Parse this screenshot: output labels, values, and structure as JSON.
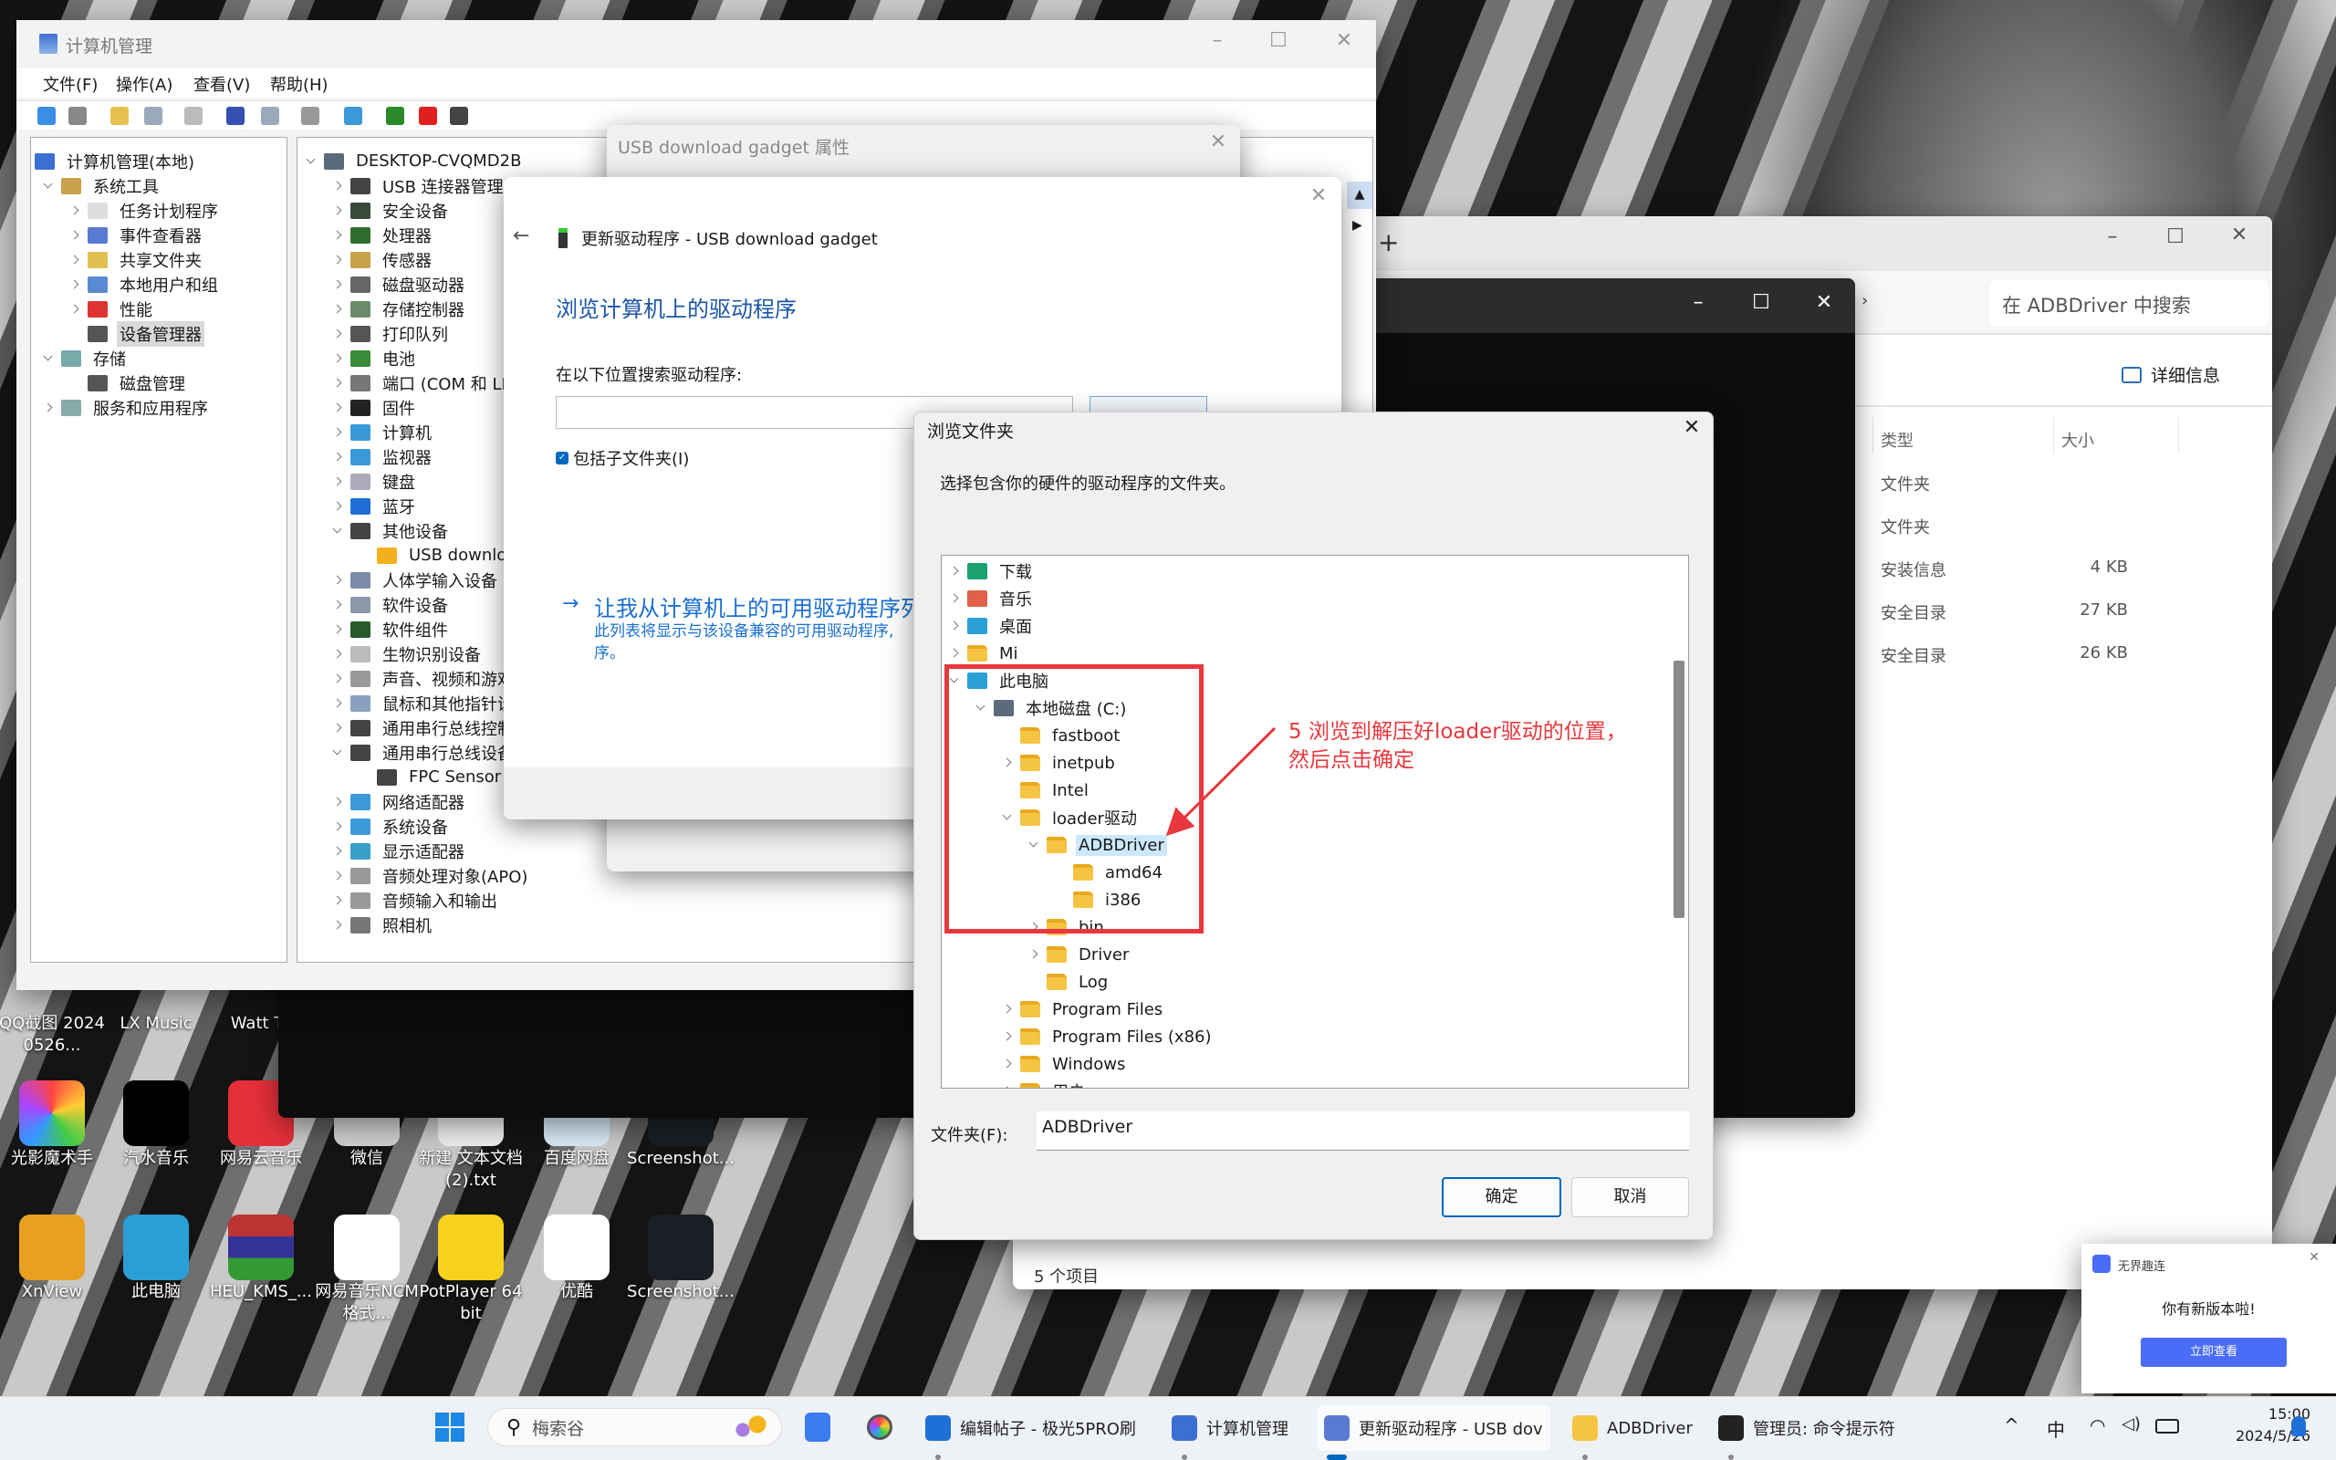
{
  "colors": {
    "accent": "#0067c0",
    "annotation_red": "#e8383d",
    "heading_blue": "#1c56a8",
    "notification_button": "#4a6cf7"
  },
  "desktop": {
    "row0": [
      {
        "label": "QQ截图 20240526..."
      },
      {
        "label": "LX Music"
      },
      {
        "label": "Watt To"
      }
    ],
    "row1": [
      {
        "label": "光影魔术手",
        "icon": "neo-imaging-icon"
      },
      {
        "label": "汽水音乐",
        "icon": "qishui-music-icon"
      },
      {
        "label": "网易云音乐",
        "icon": "netease-music-icon"
      },
      {
        "label": "微信",
        "icon": "wechat-icon"
      },
      {
        "label": "新建 文本文档 (2).txt",
        "icon": "text-file-icon"
      },
      {
        "label": "百度网盘",
        "icon": "baidu-netdisk-icon"
      },
      {
        "label": "Screenshot...",
        "icon": "screenshot-file-icon"
      }
    ],
    "row2": [
      {
        "label": "XnView",
        "icon": "xnview-icon"
      },
      {
        "label": "此电脑",
        "icon": "this-pc-icon"
      },
      {
        "label": "HEU_KMS_...",
        "icon": "winrar-icon"
      },
      {
        "label": "网易音乐NCM格式...",
        "icon": "ncm-converter-icon"
      },
      {
        "label": "PotPlayer 64 bit",
        "icon": "potplayer-icon"
      },
      {
        "label": "优酷",
        "icon": "youku-icon"
      },
      {
        "label": "Screenshot...",
        "icon": "screenshot-file-icon"
      }
    ]
  },
  "explorer": {
    "search_placeholder": "在 ADBDriver 中搜索",
    "details_label": "详细信息",
    "columns": [
      "类型",
      "大小"
    ],
    "rows": [
      {
        "type": "文件夹",
        "size": ""
      },
      {
        "type": "文件夹",
        "size": ""
      },
      {
        "type": "安装信息",
        "size": "4 KB"
      },
      {
        "type": "安全目录",
        "size": "27 KB"
      },
      {
        "type": "安全目录",
        "size": "26 KB"
      }
    ],
    "status": "5 个项目"
  },
  "computer_management": {
    "title": "计算机管理",
    "menu": [
      "文件(F)",
      "操作(A)",
      "查看(V)",
      "帮助(H)"
    ],
    "left_tree": [
      {
        "label": "计算机管理(本地)",
        "level": 0,
        "state": "none",
        "icon": "computer-management-icon"
      },
      {
        "label": "系统工具",
        "level": 1,
        "state": "expanded",
        "icon": "system-tools-icon"
      },
      {
        "label": "任务计划程序",
        "level": 2,
        "state": "collapsed",
        "icon": "task-scheduler-icon"
      },
      {
        "label": "事件查看器",
        "level": 2,
        "state": "collapsed",
        "icon": "event-viewer-icon"
      },
      {
        "label": "共享文件夹",
        "level": 2,
        "state": "collapsed",
        "icon": "shared-folders-icon"
      },
      {
        "label": "本地用户和组",
        "level": 2,
        "state": "collapsed",
        "icon": "users-icon"
      },
      {
        "label": "性能",
        "level": 2,
        "state": "collapsed",
        "icon": "performance-icon"
      },
      {
        "label": "设备管理器",
        "level": 2,
        "state": "none",
        "icon": "device-manager-icon",
        "selected": true
      },
      {
        "label": "存储",
        "level": 1,
        "state": "expanded",
        "icon": "storage-icon"
      },
      {
        "label": "磁盘管理",
        "level": 2,
        "state": "none",
        "icon": "disk-management-icon"
      },
      {
        "label": "服务和应用程序",
        "level": 1,
        "state": "collapsed",
        "icon": "services-icon"
      }
    ],
    "device_tree": [
      {
        "label": "DESKTOP-CVQMD2B",
        "level": 0,
        "state": "expanded",
        "icon": "computer-icon"
      },
      {
        "label": "USB 连接器管理器",
        "level": 1,
        "state": "collapsed",
        "icon": "usb-icon"
      },
      {
        "label": "安全设备",
        "level": 1,
        "state": "collapsed",
        "icon": "security-icon"
      },
      {
        "label": "处理器",
        "level": 1,
        "state": "collapsed",
        "icon": "processor-icon"
      },
      {
        "label": "传感器",
        "level": 1,
        "state": "collapsed",
        "icon": "sensor-icon"
      },
      {
        "label": "磁盘驱动器",
        "level": 1,
        "state": "collapsed",
        "icon": "disk-icon"
      },
      {
        "label": "存储控制器",
        "level": 1,
        "state": "collapsed",
        "icon": "storage-controller-icon"
      },
      {
        "label": "打印队列",
        "level": 1,
        "state": "collapsed",
        "icon": "printer-icon"
      },
      {
        "label": "电池",
        "level": 1,
        "state": "collapsed",
        "icon": "battery-icon"
      },
      {
        "label": "端口 (COM 和 LP",
        "level": 1,
        "state": "collapsed",
        "icon": "port-icon"
      },
      {
        "label": "固件",
        "level": 1,
        "state": "collapsed",
        "icon": "firmware-icon"
      },
      {
        "label": "计算机",
        "level": 1,
        "state": "collapsed",
        "icon": "monitor-icon"
      },
      {
        "label": "监视器",
        "level": 1,
        "state": "collapsed",
        "icon": "monitor-icon"
      },
      {
        "label": "键盘",
        "level": 1,
        "state": "collapsed",
        "icon": "keyboard-icon"
      },
      {
        "label": "蓝牙",
        "level": 1,
        "state": "collapsed",
        "icon": "bluetooth-icon"
      },
      {
        "label": "其他设备",
        "level": 1,
        "state": "expanded",
        "icon": "unknown-device-icon"
      },
      {
        "label": "USB downloa",
        "level": 2,
        "state": "none",
        "icon": "warning-device-icon"
      },
      {
        "label": "人体学输入设备",
        "level": 1,
        "state": "collapsed",
        "icon": "hid-icon"
      },
      {
        "label": "软件设备",
        "level": 1,
        "state": "collapsed",
        "icon": "software-device-icon"
      },
      {
        "label": "软件组件",
        "level": 1,
        "state": "collapsed",
        "icon": "software-component-icon"
      },
      {
        "label": "生物识别设备",
        "level": 1,
        "state": "collapsed",
        "icon": "biometric-icon"
      },
      {
        "label": "声音、视频和游戏",
        "level": 1,
        "state": "collapsed",
        "icon": "speaker-icon"
      },
      {
        "label": "鼠标和其他指针设",
        "level": 1,
        "state": "collapsed",
        "icon": "mouse-icon"
      },
      {
        "label": "通用串行总线控制",
        "level": 1,
        "state": "collapsed",
        "icon": "usb-icon"
      },
      {
        "label": "通用串行总线设备",
        "level": 1,
        "state": "expanded",
        "icon": "usb-icon"
      },
      {
        "label": "FPC Sensor C",
        "level": 2,
        "state": "none",
        "icon": "usb-icon"
      },
      {
        "label": "网络适配器",
        "level": 1,
        "state": "collapsed",
        "icon": "network-icon"
      },
      {
        "label": "系统设备",
        "level": 1,
        "state": "collapsed",
        "icon": "system-device-icon"
      },
      {
        "label": "显示适配器",
        "level": 1,
        "state": "collapsed",
        "icon": "display-adapter-icon"
      },
      {
        "label": "音频处理对象(APO)",
        "level": 1,
        "state": "collapsed",
        "icon": "speaker-icon"
      },
      {
        "label": "音频输入和输出",
        "level": 1,
        "state": "collapsed",
        "icon": "speaker-icon"
      },
      {
        "label": "照相机",
        "level": 1,
        "state": "collapsed",
        "icon": "camera-icon"
      }
    ]
  },
  "properties_dialog": {
    "title": "USB download gadget 属性"
  },
  "update_driver": {
    "title": "更新驱动程序 - USB download gadget",
    "heading": "浏览计算机上的驱动程序",
    "search_label": "在以下位置搜索驱动程序:",
    "path_value": "",
    "include_subfolders": "包括子文件夹(I)",
    "include_subfolders_checked": true,
    "pick_link": "让我从计算机上的可用驱动程序列",
    "pick_desc_line1": "此列表将显示与该设备兼容的可用驱动程序,",
    "pick_desc_line2": "序。"
  },
  "browse_folder": {
    "title": "浏览文件夹",
    "description": "选择包含你的硬件的驱动程序的文件夹。",
    "tree": [
      {
        "label": "下载",
        "level": 0,
        "state": "collapsed",
        "icon": "download-icon"
      },
      {
        "label": "音乐",
        "level": 0,
        "state": "collapsed",
        "icon": "music-icon"
      },
      {
        "label": "桌面",
        "level": 0,
        "state": "collapsed",
        "icon": "desktop-icon"
      },
      {
        "label": "Mi",
        "level": 0,
        "state": "collapsed",
        "icon": "folder-icon"
      },
      {
        "label": "此电脑",
        "level": 0,
        "state": "expanded",
        "icon": "this-pc-icon"
      },
      {
        "label": "本地磁盘 (C:)",
        "level": 1,
        "state": "expanded",
        "icon": "drive-icon"
      },
      {
        "label": "fastboot",
        "level": 2,
        "state": "none",
        "icon": "folder-icon"
      },
      {
        "label": "inetpub",
        "level": 2,
        "state": "collapsed",
        "icon": "folder-icon"
      },
      {
        "label": "Intel",
        "level": 2,
        "state": "none",
        "icon": "folder-icon"
      },
      {
        "label": "loader驱动",
        "level": 2,
        "state": "expanded",
        "icon": "folder-icon"
      },
      {
        "label": "ADBDriver",
        "level": 3,
        "state": "expanded",
        "icon": "folder-icon",
        "selected": true
      },
      {
        "label": "amd64",
        "level": 4,
        "state": "none",
        "icon": "folder-icon"
      },
      {
        "label": "i386",
        "level": 4,
        "state": "none",
        "icon": "folder-icon"
      },
      {
        "label": "bin",
        "level": 3,
        "state": "collapsed",
        "icon": "folder-icon"
      },
      {
        "label": "Driver",
        "level": 3,
        "state": "collapsed",
        "icon": "folder-icon"
      },
      {
        "label": "Log",
        "level": 3,
        "state": "none",
        "icon": "folder-icon"
      },
      {
        "label": "Program Files",
        "level": 2,
        "state": "collapsed",
        "icon": "folder-icon"
      },
      {
        "label": "Program Files (x86)",
        "level": 2,
        "state": "collapsed",
        "icon": "folder-icon"
      },
      {
        "label": "Windows",
        "level": 2,
        "state": "collapsed",
        "icon": "folder-icon"
      },
      {
        "label": "用户",
        "level": 2,
        "state": "collapsed",
        "icon": "folder-icon"
      }
    ],
    "folder_label": "文件夹(F):",
    "folder_value": "ADBDriver",
    "ok": "确定",
    "cancel": "取消",
    "annotation_line1": "5 浏览到解压好loader驱动的位置，",
    "annotation_line2": "然后点击确定"
  },
  "taskbar": {
    "search_placeholder": "梅索谷",
    "apps": [
      {
        "label": "编辑帖子 - 极光5PRO刷",
        "icon": "sogou-browser-icon"
      },
      {
        "label": "计算机管理",
        "icon": "computer-management-icon"
      },
      {
        "label": "更新驱动程序 - USB dov",
        "icon": "device-installer-icon",
        "active": true
      },
      {
        "label": "ADBDriver",
        "icon": "folder-icon"
      },
      {
        "label": "管理员: 命令提示符",
        "icon": "cmd-icon"
      }
    ],
    "ime": "中",
    "time": "15:00",
    "date": "2024/5/26"
  },
  "notification": {
    "app": "无界趣连",
    "message": "你有新版本啦!",
    "button": "立即查看"
  }
}
